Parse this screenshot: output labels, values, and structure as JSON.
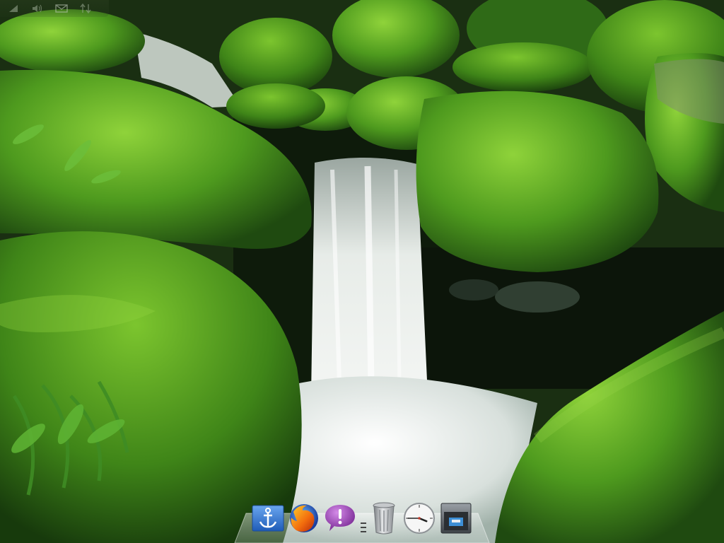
{
  "desktop": {
    "wallpaper_subject": "waterfall-moss-rocks",
    "colors": {
      "moss_light": "#6dbb2c",
      "moss_dark": "#2c6414",
      "water": "#e9eeea",
      "shadow": "#0d1a0a"
    }
  },
  "tray": {
    "icons": [
      {
        "name": "network-icon"
      },
      {
        "name": "volume-icon"
      },
      {
        "name": "mail-icon"
      },
      {
        "name": "transfer-icon"
      }
    ]
  },
  "dock": {
    "items": [
      {
        "name": "anchor-launcher-icon",
        "color": "#2a6fcf"
      },
      {
        "name": "firefox-icon",
        "color": "#e66000"
      },
      {
        "name": "notification-bubble-icon",
        "color": "#8f3fa8"
      },
      {
        "name": "trash-icon",
        "color": "#9a9ea2"
      },
      {
        "name": "clock-icon",
        "color": "#f4f4f4",
        "hour": 3,
        "minute": 45
      },
      {
        "name": "file-drawer-icon",
        "color": "#5a6066"
      }
    ]
  }
}
